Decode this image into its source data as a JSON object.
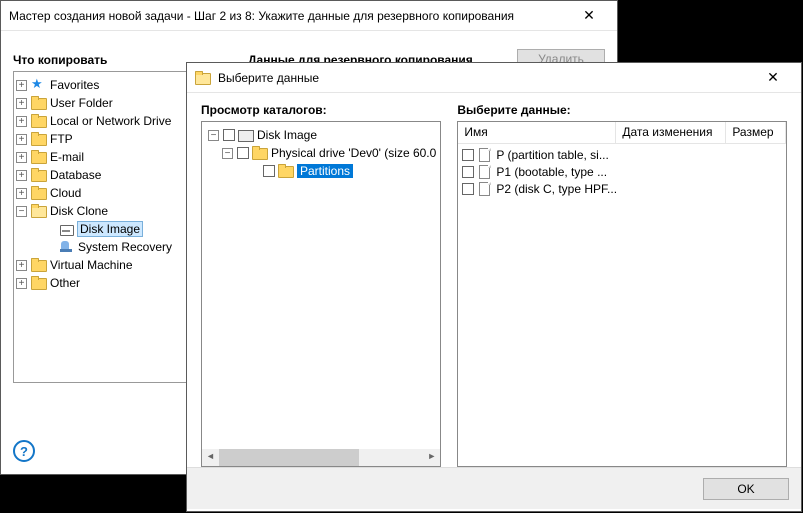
{
  "wizard": {
    "title": "Мастер создания новой задачи - Шаг 2 из 8: Укажите данные для резервного копирования",
    "what_header": "Что копировать",
    "data_header": "Данные для резервного копирования",
    "delete_btn": "Удалить",
    "help": "?",
    "tree": [
      {
        "exp": "+",
        "icon": "star",
        "label": "Favorites",
        "indent": 0
      },
      {
        "exp": "+",
        "icon": "folder",
        "label": "User Folder",
        "indent": 0
      },
      {
        "exp": "+",
        "icon": "folder",
        "label": "Local or Network Drive",
        "indent": 0
      },
      {
        "exp": "+",
        "icon": "folder",
        "label": "FTP",
        "indent": 0
      },
      {
        "exp": "+",
        "icon": "folder",
        "label": "E-mail",
        "indent": 0
      },
      {
        "exp": "+",
        "icon": "folder",
        "label": "Database",
        "indent": 0
      },
      {
        "exp": "+",
        "icon": "folder",
        "label": "Cloud",
        "indent": 0
      },
      {
        "exp": "−",
        "icon": "folder open",
        "label": "Disk Clone",
        "indent": 0
      },
      {
        "exp": "",
        "icon": "disk",
        "label": "Disk Image",
        "indent": 1,
        "selected": true
      },
      {
        "exp": "",
        "icon": "recov",
        "label": "System Recovery",
        "indent": 1
      },
      {
        "exp": "+",
        "icon": "folder",
        "label": "Virtual Machine",
        "indent": 0
      },
      {
        "exp": "+",
        "icon": "folder",
        "label": "Other",
        "indent": 0
      }
    ]
  },
  "picker": {
    "title": "Выберите данные",
    "browse_header": "Просмотр каталогов:",
    "select_header": "Выберите данные:",
    "tree": {
      "root": "Disk Image",
      "drive": "Physical drive 'Dev0' (size 60.0",
      "partitions": "Partitions"
    },
    "list": {
      "col_name": "Имя",
      "col_date": "Дата изменения",
      "col_size": "Размер",
      "rows": [
        "P (partition table, si...",
        "P1 (bootable, type ...",
        "P2 (disk C, type HPF..."
      ]
    },
    "ok_btn": "OK"
  }
}
